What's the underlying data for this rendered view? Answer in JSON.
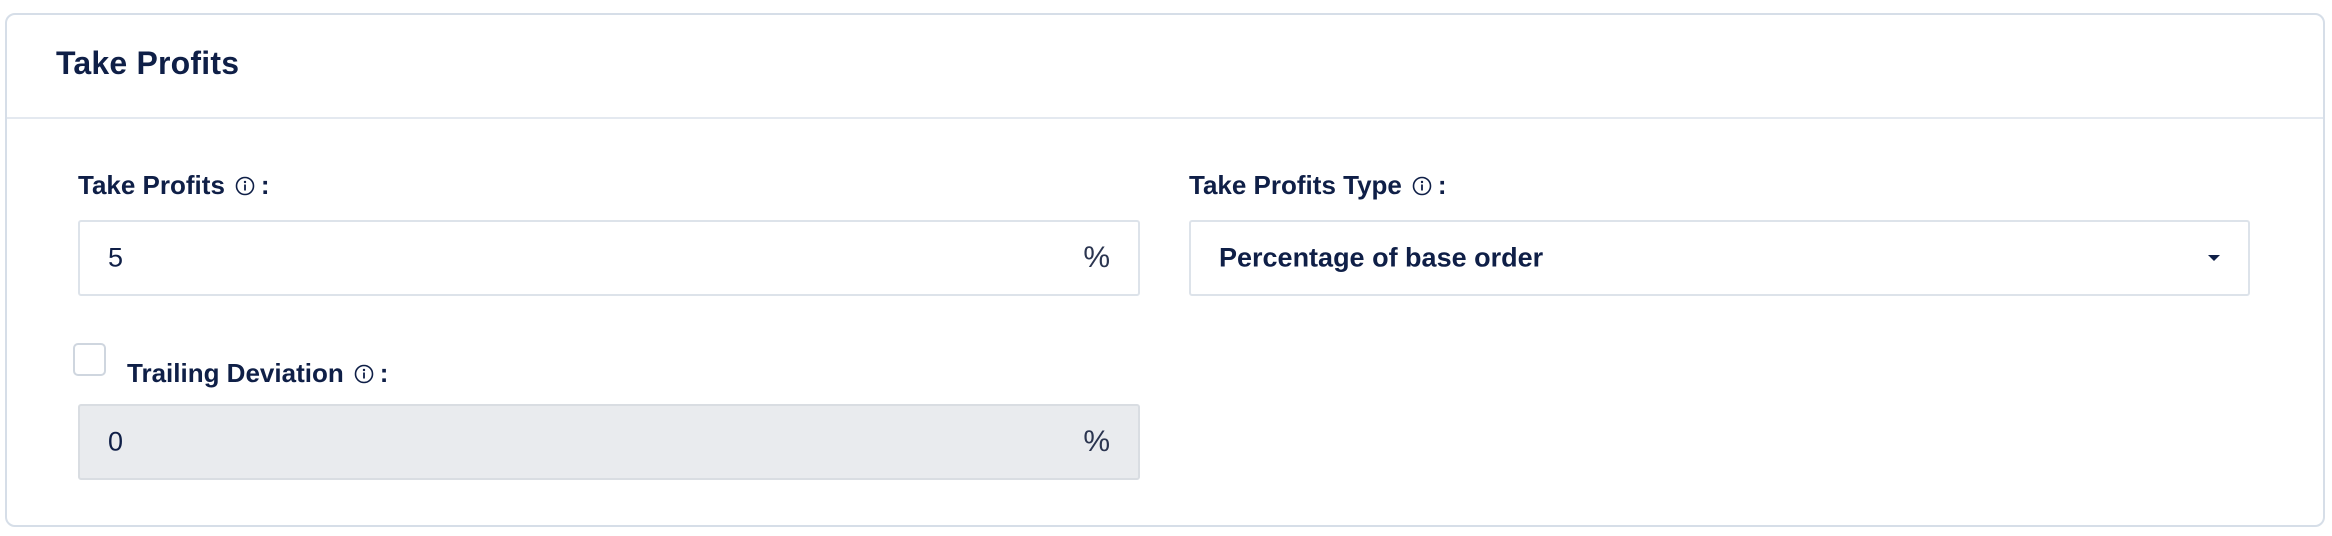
{
  "card": {
    "title": "Take Profits"
  },
  "take_profits": {
    "label": "Take Profits",
    "colon": ":",
    "value": "5",
    "suffix": "%",
    "info_icon": "info-icon"
  },
  "take_profits_type": {
    "label": "Take Profits Type",
    "colon": ":",
    "selected": "Percentage of base order",
    "info_icon": "info-icon",
    "dropdown_icon": "caret-down-icon"
  },
  "trailing_deviation": {
    "label": "Trailing Deviation",
    "colon": ":",
    "value": "0",
    "suffix": "%",
    "checked": false,
    "disabled": true,
    "info_icon": "info-icon"
  },
  "colors": {
    "text": "#0f1f47",
    "border": "#dde3ea",
    "disabled_bg": "#e9ebee"
  }
}
